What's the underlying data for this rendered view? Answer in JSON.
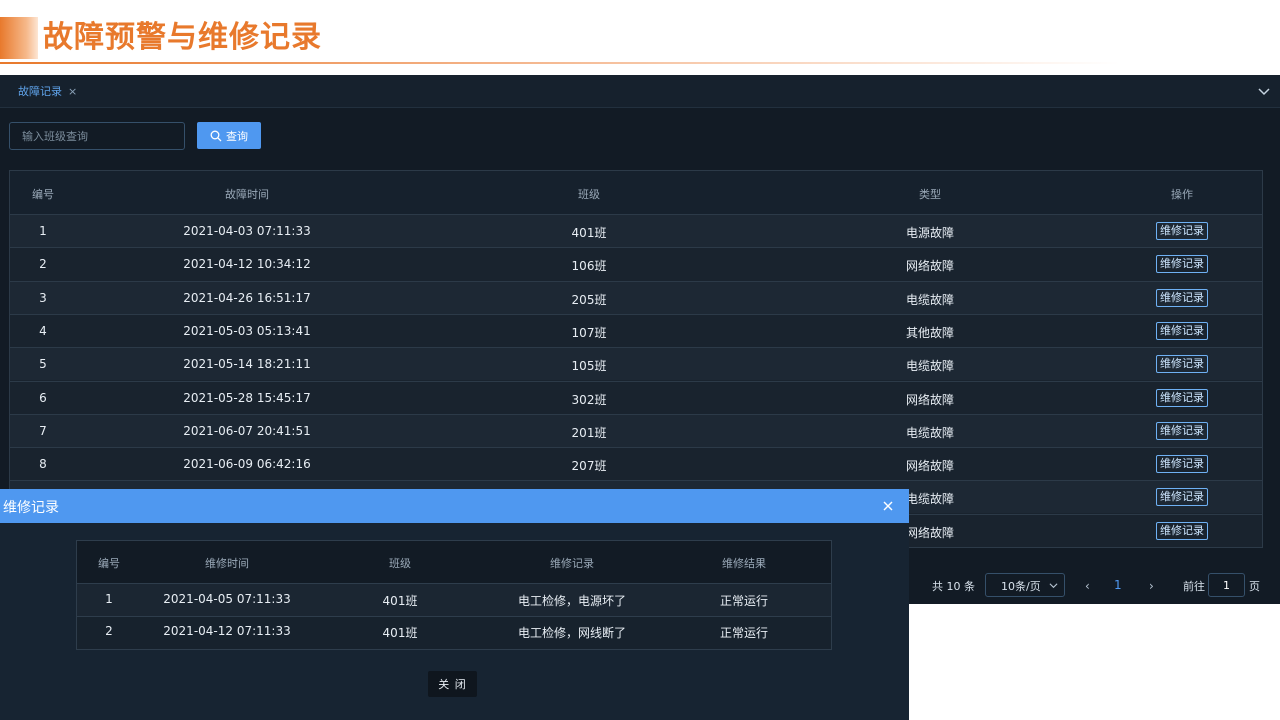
{
  "slide": {
    "title": "故障预警与维修记录"
  },
  "tabs": [
    {
      "label": "故障记录",
      "close": "×"
    }
  ],
  "search": {
    "placeholder": "输入班级查询",
    "button_label": "查询"
  },
  "table": {
    "headers": [
      "编号",
      "故障时间",
      "班级",
      "类型",
      "操作"
    ],
    "rows": [
      {
        "id": "1",
        "time": "2021-04-03 07:11:33",
        "class": "401班",
        "type": "电源故障",
        "action": "维修记录"
      },
      {
        "id": "2",
        "time": "2021-04-12 10:34:12",
        "class": "106班",
        "type": "网络故障",
        "action": "维修记录"
      },
      {
        "id": "3",
        "time": "2021-04-26 16:51:17",
        "class": "205班",
        "type": "电缆故障",
        "action": "维修记录"
      },
      {
        "id": "4",
        "time": "2021-05-03 05:13:41",
        "class": "107班",
        "type": "其他故障",
        "action": "维修记录"
      },
      {
        "id": "5",
        "time": "2021-05-14 18:21:11",
        "class": "105班",
        "type": "电缆故障",
        "action": "维修记录"
      },
      {
        "id": "6",
        "time": "2021-05-28 15:45:17",
        "class": "302班",
        "type": "网络故障",
        "action": "维修记录"
      },
      {
        "id": "7",
        "time": "2021-06-07 20:41:51",
        "class": "201班",
        "type": "电缆故障",
        "action": "维修记录"
      },
      {
        "id": "8",
        "time": "2021-06-09 06:42:16",
        "class": "207班",
        "type": "网络故障",
        "action": "维修记录"
      },
      {
        "id": "",
        "time": "",
        "class": "",
        "type": "电缆故障",
        "action": "维修记录"
      },
      {
        "id": "",
        "time": "",
        "class": "",
        "type": "网络故障",
        "action": "维修记录"
      }
    ]
  },
  "pagination": {
    "total_text": "共 10 条",
    "page_size": "10条/页",
    "prev": "‹",
    "current_page": "1",
    "next": "›",
    "goto_label": "前往",
    "goto_value": "1",
    "page_suffix": "页"
  },
  "modal": {
    "title": "维修记录",
    "headers": [
      "编号",
      "维修时间",
      "班级",
      "维修记录",
      "维修结果"
    ],
    "rows": [
      {
        "id": "1",
        "time": "2021-04-05 07:11:33",
        "class": "401班",
        "record": "电工检修，电源坏了",
        "result": "正常运行"
      },
      {
        "id": "2",
        "time": "2021-04-12 07:11:33",
        "class": "401班",
        "record": "电工检修，网线断了",
        "result": "正常运行"
      }
    ],
    "close_label": "关 闭"
  },
  "colors": {
    "accent": "#e8792c",
    "primary": "#4f98f0",
    "panel_bg": "#121b25"
  }
}
